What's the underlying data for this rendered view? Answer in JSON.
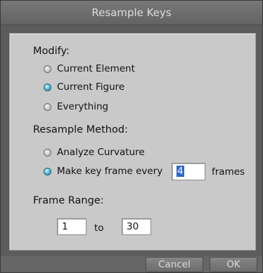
{
  "dialog": {
    "title": "Resample Keys"
  },
  "modify": {
    "label": "Modify:",
    "options": [
      {
        "label": "Current Element",
        "selected": false
      },
      {
        "label": "Current Figure",
        "selected": true
      },
      {
        "label": "Everything",
        "selected": false
      }
    ]
  },
  "resample_method": {
    "label": "Resample Method:",
    "options": [
      {
        "label": "Analyze Curvature",
        "selected": false
      },
      {
        "label": "Make key frame every",
        "selected": true
      }
    ],
    "interval_value": "4",
    "interval_suffix": "frames"
  },
  "frame_range": {
    "label": "Frame Range:",
    "start": "1",
    "separator": "to",
    "end": "30"
  },
  "buttons": {
    "cancel": "Cancel",
    "ok": "OK"
  },
  "colors": {
    "radio_selected": "#4fb8d8",
    "panel_bg": "#c9c9c9",
    "dialog_bg": "#5c5c5c"
  }
}
